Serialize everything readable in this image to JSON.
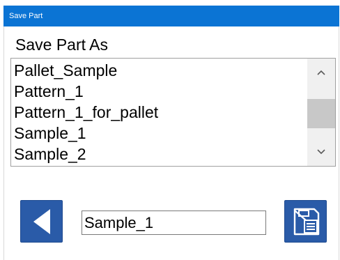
{
  "window": {
    "title": "Save Part"
  },
  "dialog": {
    "heading": "Save Part As"
  },
  "part_list": {
    "items": [
      "Pallet_Sample",
      "Pattern_1",
      "Pattern_1_for_pallet",
      "Sample_1",
      "Sample_2"
    ]
  },
  "scrollbar": {
    "up_icon": "chevron-up-icon",
    "down_icon": "chevron-down-icon"
  },
  "name_field": {
    "value": "Sample_1"
  },
  "buttons": {
    "back_icon": "triangle-left-icon",
    "save_icon": "floppy-disk-icon"
  },
  "colors": {
    "titlebar": "#0b74d4",
    "button": "#2a5ba8",
    "scroll_thumb": "#c8c8c8"
  }
}
